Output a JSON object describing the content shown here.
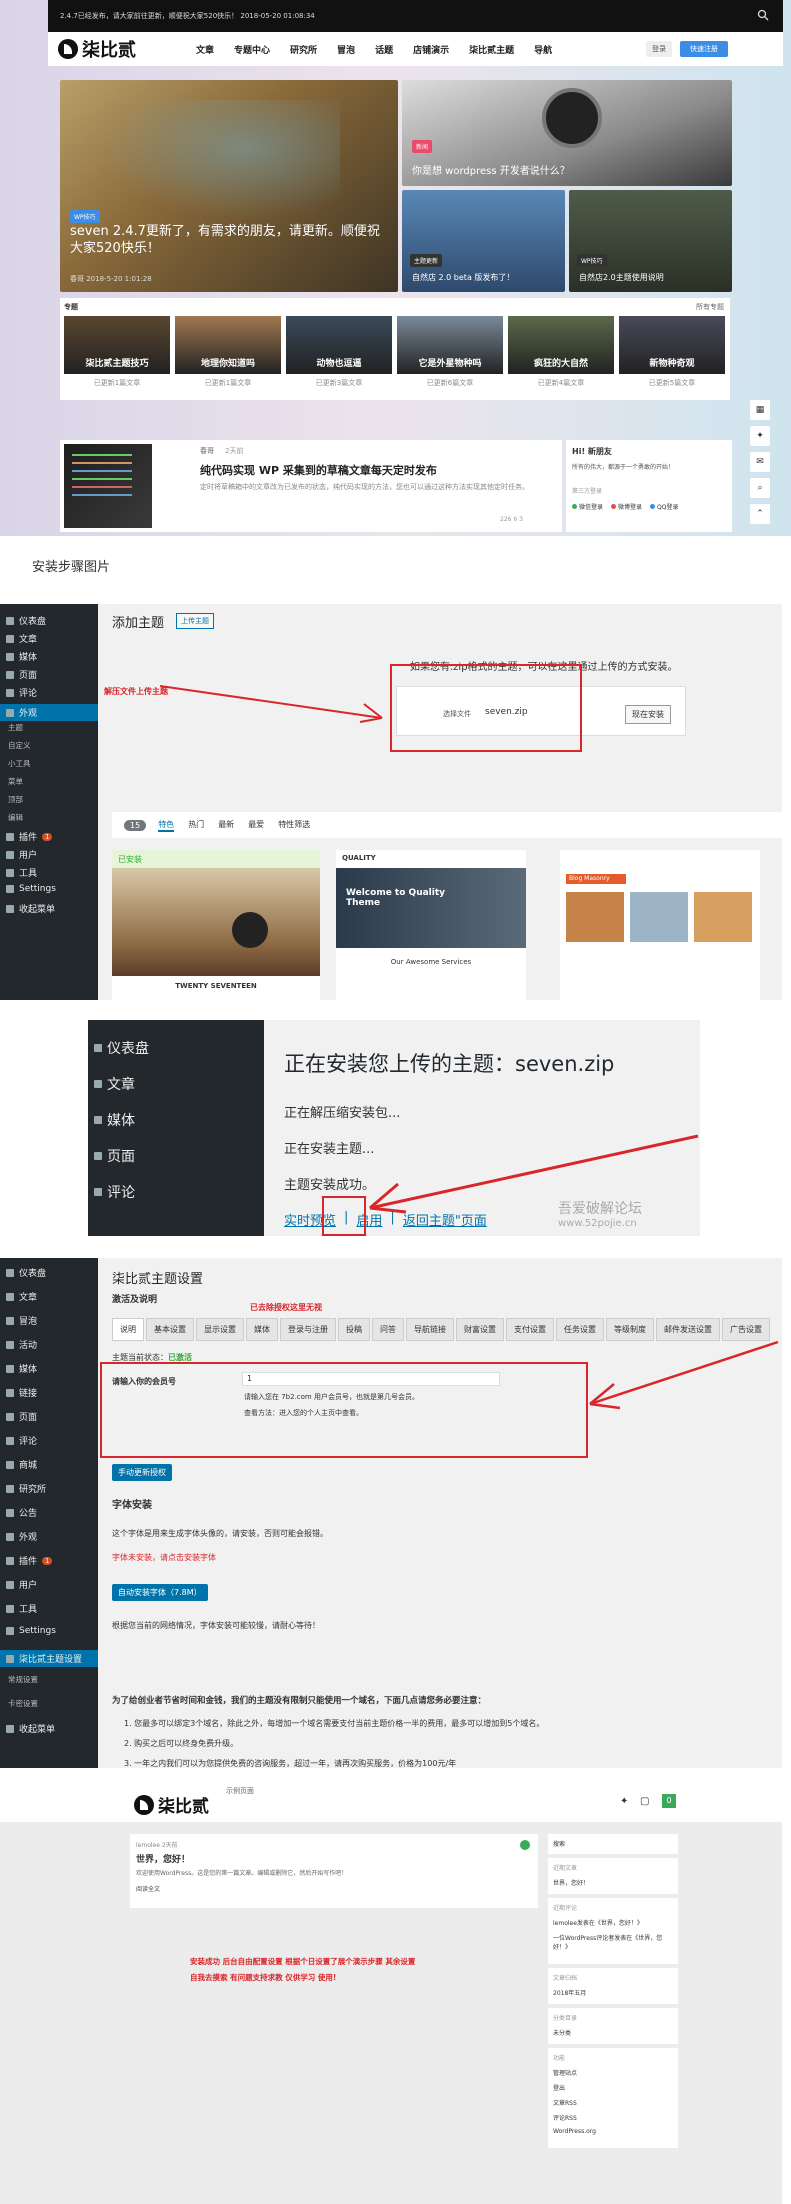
{
  "demo": {
    "announcement": "2.4.7已经发布，请大家前往更新，顺便祝大家520快乐！   2018-05-20 01:08:34",
    "logo_text": "柒比贰",
    "nav": [
      "文章",
      "专题中心",
      "研究所",
      "冒泡",
      "话题",
      "店铺演示",
      "柒比贰主题",
      "导航"
    ],
    "login": "登录",
    "register": "快速注册",
    "hero_main_tag": "WP技巧",
    "hero_main_title": "seven 2.4.7更新了，有需求的朋友，请更新。顺便祝大家520快乐！",
    "hero_main_meta": "春哥   2018-5-20 1:01:28",
    "hero_tr_tag": "新闻",
    "hero_tr_title": "你是想 wordpress 开发者说什么？",
    "hero_bl_tag": "主题更新",
    "hero_bl_title": "自然店 2.0 beta 版发布了！",
    "hero_br_tag": "WP技巧",
    "hero_br_title": "自然店2.0主题使用说明",
    "topics_label": "专题",
    "topics_all": "所有专题",
    "topics": [
      {
        "name": "柒比贰主题技巧",
        "count": "已更新1篇文章"
      },
      {
        "name": "地理你知道吗",
        "count": "已更新1篇文章"
      },
      {
        "name": "动物也逗逼",
        "count": "已更新3篇文章"
      },
      {
        "name": "它是外星物种吗",
        "count": "已更新6篇文章"
      },
      {
        "name": "疯狂的大自然",
        "count": "已更新4篇文章"
      },
      {
        "name": "新物种奇观",
        "count": "已更新5篇文章"
      }
    ],
    "post_author": "春哥",
    "post_time": "2天前",
    "post_title": "纯代码实现 WP 采集到的草稿文章每天定时发布",
    "post_excerpt": "定时将草稿箱中的文章改为已发布的状态，纯代码实现的方法，您也可以通过这种方法实现其他定时任务。",
    "post_stats": "226   6   3",
    "side_greet": "Hi! 新朋友",
    "side_sub": "所有的伟大，都源于一个勇敢的开始！",
    "side_login_label": "第三方登录",
    "side_logins": [
      "微信登录",
      "微博登录",
      "QQ登录"
    ]
  },
  "step_label": "安装步骤图片",
  "s2": {
    "menu": [
      "仪表盘",
      "文章",
      "媒体",
      "页面",
      "评论",
      "外观",
      "主题",
      "自定义",
      "小工具",
      "菜单",
      "顶部",
      "编辑",
      "插件",
      "用户",
      "工具",
      "Settings",
      "收起菜单"
    ],
    "plugin_badge": "1",
    "page_title": "添加主题",
    "upload_btn": "上传主题",
    "annotation": "解压文件上传主题",
    "upload_tip": "如果您有.zip格式的主题，可以在这里通过上传的方式安装。",
    "choose_file": "选择文件",
    "filename": "seven.zip",
    "install_btn": "现在安装",
    "count": "15",
    "filters": [
      "特色",
      "热门",
      "最新",
      "最爱",
      "特性筛选"
    ],
    "installed": "已安装",
    "theme1": "TWENTY SEVENTEEN",
    "theme2_brand": "QUALITY",
    "theme2_title": "Welcome to Quality Theme",
    "theme2_sub": "Our Awesome Services",
    "theme3_heading": "Blog Masonry"
  },
  "s3": {
    "menu": [
      "仪表盘",
      "文章",
      "媒体",
      "页面",
      "评论"
    ],
    "title": "正在安装您上传的主题：seven.zip",
    "line1": "正在解压缩安装包...",
    "line2": "正在安装主题...",
    "line3": "主题安装成功。",
    "link1": "实时预览",
    "link2": "启用",
    "link3": "返回主题\"页面",
    "watermark1": "吾爱破解论坛",
    "watermark2": "www.52pojie.cn"
  },
  "s4": {
    "menu": [
      "仪表盘",
      "文章",
      "冒泡",
      "活动",
      "媒体",
      "链接",
      "页面",
      "评论",
      "商城",
      "研究所",
      "公告",
      "外观",
      "插件",
      "用户",
      "工具",
      "Settings",
      "柒比贰主题设置",
      "常规设置",
      "卡密设置",
      "收起菜单"
    ],
    "title": "柒比贰主题设置",
    "subtitle": "激活及说明",
    "annotation": "已去除授权这里无视",
    "tabs": [
      "说明",
      "基本设置",
      "显示设置",
      "媒体",
      "登录与注册",
      "投稿",
      "问答",
      "导航链接",
      "财富设置",
      "支付设置",
      "任务设置",
      "等级制度",
      "邮件发送设置",
      "广告设置"
    ],
    "status_label": "主题当前状态：",
    "status_value": "已激活",
    "member_label": "请输入你的会员号",
    "member_value": "1",
    "member_tip1": "请输入您在 7b2.com 用户会员号，也就是第几号会员。",
    "member_tip2": "查看方法：进入您的个人主页中查看。",
    "update_btn": "手动更新授权",
    "font_title": "字体安装",
    "font_desc": "这个字体是用来生成字体头像的，请安装，否则可能会报错。",
    "font_warn": "字体未安装，请点击安装字体",
    "font_btn": "自动安装字体（7.8M）",
    "font_note": "根据您当前的网络情况，字体安装可能较慢，请耐心等待！",
    "notice_title": "为了给创业者节省时间和金钱，我们的主题没有限制只能使用一个域名，下面几点请您务必要注意：",
    "notice1": "1. 您最多可以绑定3个域名，除此之外，每增加一个域名需要支付当前主题价格一半的费用，最多可以增加到5个域名。",
    "notice2": "2. 购买之后可以终身免费升级。",
    "notice3": "3. 一年之内我们可以为您提供免费的咨询服务，超过一年，请再次购买服务，价格为100元/年"
  },
  "s5": {
    "logo": "柒比贰",
    "nav_hint": "示例页面",
    "badge": "0",
    "post_meta": "lemolee   2天前",
    "post_title": "世界，您好！",
    "post_body": "欢迎使用WordPress。这是您的第一篇文章。编辑或删除它，然后开始写作吧！",
    "post_more": "阅读全文",
    "note1": "安装成功  后台自由配置设置 根据个日设置了展个演示步骤 其余设置",
    "note2": "自我去摸索 有问题支持求教 仅供学习 使用!",
    "w_search": "搜索",
    "w_recent": "近期文章",
    "w_recent1": "世界，您好！",
    "w_comments": "近期评论",
    "w_c1": "lemolee发表在《世界，您好！》",
    "w_c2": "一位WordPress评论者发表在《世界，您好！》",
    "w_archive": "文章归档",
    "w_archive1": "2018年五月",
    "w_cat": "分类目录",
    "w_cat1": "未分类",
    "w_meta": "功能",
    "w_meta_items": [
      "管理站点",
      "登出",
      "文章RSS",
      "评论RSS",
      "WordPress.org"
    ]
  }
}
